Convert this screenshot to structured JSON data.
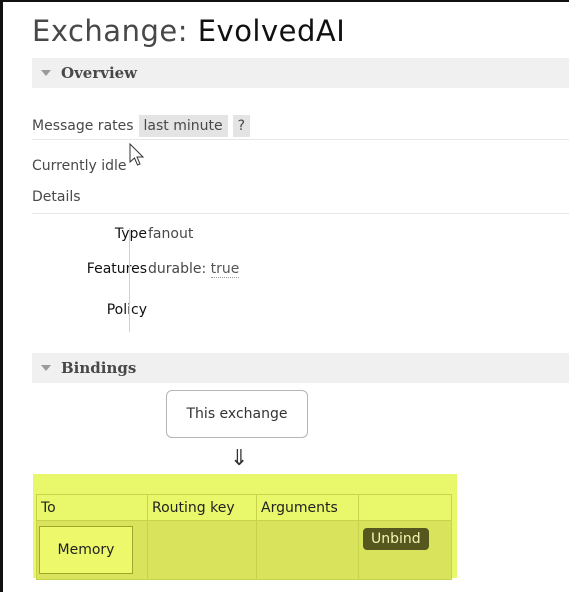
{
  "page": {
    "title_prefix": "Exchange: ",
    "title_name": "EvolvedAI"
  },
  "overview": {
    "header": "Overview",
    "message_rates_label": "Message rates",
    "rate_window": "last minute",
    "help": "?",
    "status": "Currently idle",
    "details_label": "Details",
    "details": [
      {
        "key": "Type",
        "value": "fanout"
      },
      {
        "key": "Features",
        "value_label": "durable:",
        "value": "true"
      },
      {
        "key": "Policy",
        "value": ""
      }
    ]
  },
  "bindings": {
    "header": "Bindings",
    "source": "This exchange",
    "arrow": "⇓",
    "columns": [
      "To",
      "Routing key",
      "Arguments",
      ""
    ],
    "rows": [
      {
        "to": "Memory",
        "routing_key": "",
        "arguments": "",
        "action": "Unbind"
      }
    ]
  },
  "colors": {
    "highlight": "#e9f76a",
    "unbind_button": "#55571e"
  }
}
